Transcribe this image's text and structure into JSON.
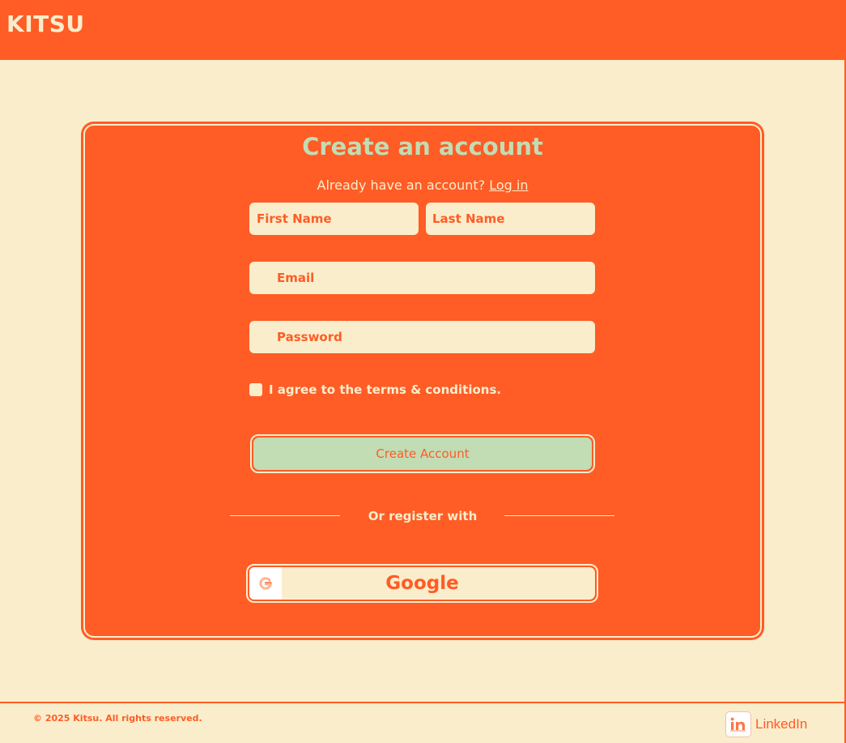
{
  "header": {
    "brand": "KITSU"
  },
  "signup": {
    "title": "Create an account",
    "login_prompt": "Already have an account?",
    "login_link": "Log in",
    "first_name_placeholder": "First Name",
    "last_name_placeholder": "Last Name",
    "email_placeholder": "Email",
    "password_placeholder": "Password",
    "terms_label": "I agree to the terms & conditions.",
    "submit_label": "Create Account",
    "divider_label": "Or register with",
    "google_label": "Google"
  },
  "footer": {
    "copyright": "© 2025 Kitsu. All rights reserved.",
    "linkedin_label": "LinkedIn"
  },
  "icons": {
    "google": "google-icon",
    "linkedin": "linkedin-icon"
  },
  "colors": {
    "primary": "#ff5c26",
    "background": "#faedcb",
    "accent": "#c2dcb4"
  }
}
